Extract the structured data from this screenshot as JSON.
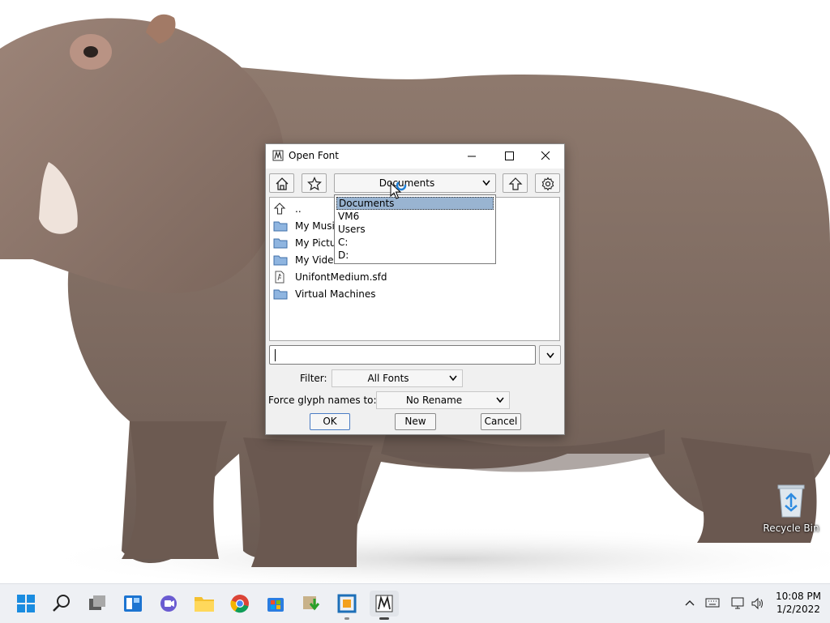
{
  "desktop": {
    "recycle_bin_label": "Recycle Bin"
  },
  "dialog": {
    "title": "Open Font",
    "window_controls": [
      "minimize",
      "maximize",
      "close"
    ],
    "toolbar": {
      "home_icon": "home-icon",
      "bookmark_icon": "star-icon",
      "path_value": "Documents",
      "up_icon": "up-arrow-icon",
      "settings_icon": "gear-icon"
    },
    "path_dropdown_options": [
      {
        "label": "Documents",
        "selected": true
      },
      {
        "label": "VM6",
        "selected": false
      },
      {
        "label": "Users",
        "selected": false
      },
      {
        "label": "C:",
        "selected": false
      },
      {
        "label": "D:",
        "selected": false
      }
    ],
    "files": [
      {
        "name": "..",
        "icon": "up-arrow-icon"
      },
      {
        "name": "My Music",
        "icon": "folder-icon"
      },
      {
        "name": "My Pictures",
        "icon": "folder-icon"
      },
      {
        "name": "My Videos",
        "icon": "folder-icon"
      },
      {
        "name": "UnifontMedium.sfd",
        "icon": "font-file-icon"
      },
      {
        "name": "Virtual Machines",
        "icon": "folder-icon"
      }
    ],
    "filename_value": "",
    "filter_label": "Filter:",
    "filter_value": "All Fonts",
    "glyph_names_label": "Force glyph names to:",
    "glyph_names_value": "No Rename",
    "buttons": {
      "ok": "OK",
      "new": "New",
      "cancel": "Cancel"
    }
  },
  "taskbar": {
    "apps": [
      "start",
      "search",
      "task-view",
      "widgets",
      "chat",
      "file-explorer",
      "chrome",
      "store",
      "downloader",
      "virtualbox",
      "fontforge"
    ],
    "time": "10:08 PM",
    "date": "1/2/2022"
  }
}
